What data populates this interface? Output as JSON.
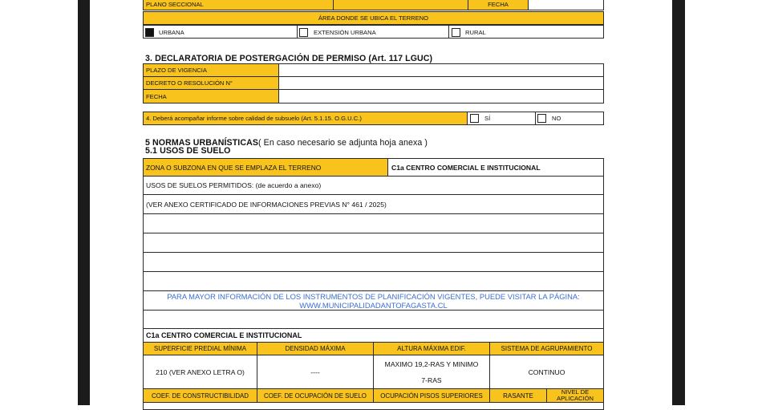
{
  "section2": {
    "plano_label": "PLANO SECCIONAL",
    "fecha_label": "FECHA",
    "area_header": "ÁREA DONDE SE UBICA EL TERRENO",
    "options": [
      {
        "label": "URBANA",
        "checked": true
      },
      {
        "label": "EXTENSIÓN URBANA",
        "checked": false
      },
      {
        "label": "RURAL",
        "checked": false
      }
    ]
  },
  "section3": {
    "title": "3. DECLARATORIA DE POSTERGACIÓN DE PERMISO (Art. 117 LGUC)",
    "rows": [
      "PLAZO DE VIGENCIA",
      "DECRETO O RESOLUCIÓN N°",
      "FECHA"
    ]
  },
  "section4": {
    "question": "4. Deberá acompañar informe sobre calidad de subsuelo (Art. 5.1.15. O.G.U.C.)",
    "yes_label": "SÍ",
    "no_label": "NO"
  },
  "section5": {
    "title": "5 NORMAS URBANÍSTICAS",
    "title_note": "( En caso necesario se adjunta hoja anexa )",
    "subtitle": "5.1 USOS DE SUELO",
    "zona_label": "ZONA O SUBZONA EN QUE SE EMPLAZA EL TERRENO",
    "zona_value": "C1a CENTRO COMERCIAL E INSTITUCIONAL",
    "usos_permitidos": "USOS DE SUELOS PERMITIDOS: (de acuerdo a anexo)",
    "ver_anexo": "(VER ANEXO CERTIFICADO DE INFORMACIONES PREVIAS N°  461 / 2025)",
    "info_line1": "PARA MAYOR INFORMACIÓN DE LOS INSTRUMENTOS DE PLANIFICACIÓN VIGENTES, PUEDE VISITAR LA PÁGINA:",
    "info_line2": "WWW.MUNICIPALIDADANTOFAGASTA.CL",
    "zone_table_title": "C1a CENTRO COMERCIAL E INSTITUCIONAL",
    "headers1": [
      "SUPERFICIE PREDIAL MÍNIMA",
      "DENSIDAD MÁXIMA",
      "ALTURA MÁXIMA EDIF.",
      "SISTEMA DE AGRUPAMIENTO"
    ],
    "values1": [
      "210 (VER ANEXO LETRA O)",
      "----",
      "MAXIMO  19,2-RAS  Y MINIMO",
      "7-RAS",
      "CONTINUO"
    ],
    "headers2": [
      "COEF. DE CONSTRUCTIBILIDAD",
      "COEF. DE OCUPACIÓN DE SUELO",
      "OCUPACIÓN PISOS SUPERIORES",
      "RASANTE",
      "NIVEL DE",
      "APLICACIÓN"
    ]
  }
}
